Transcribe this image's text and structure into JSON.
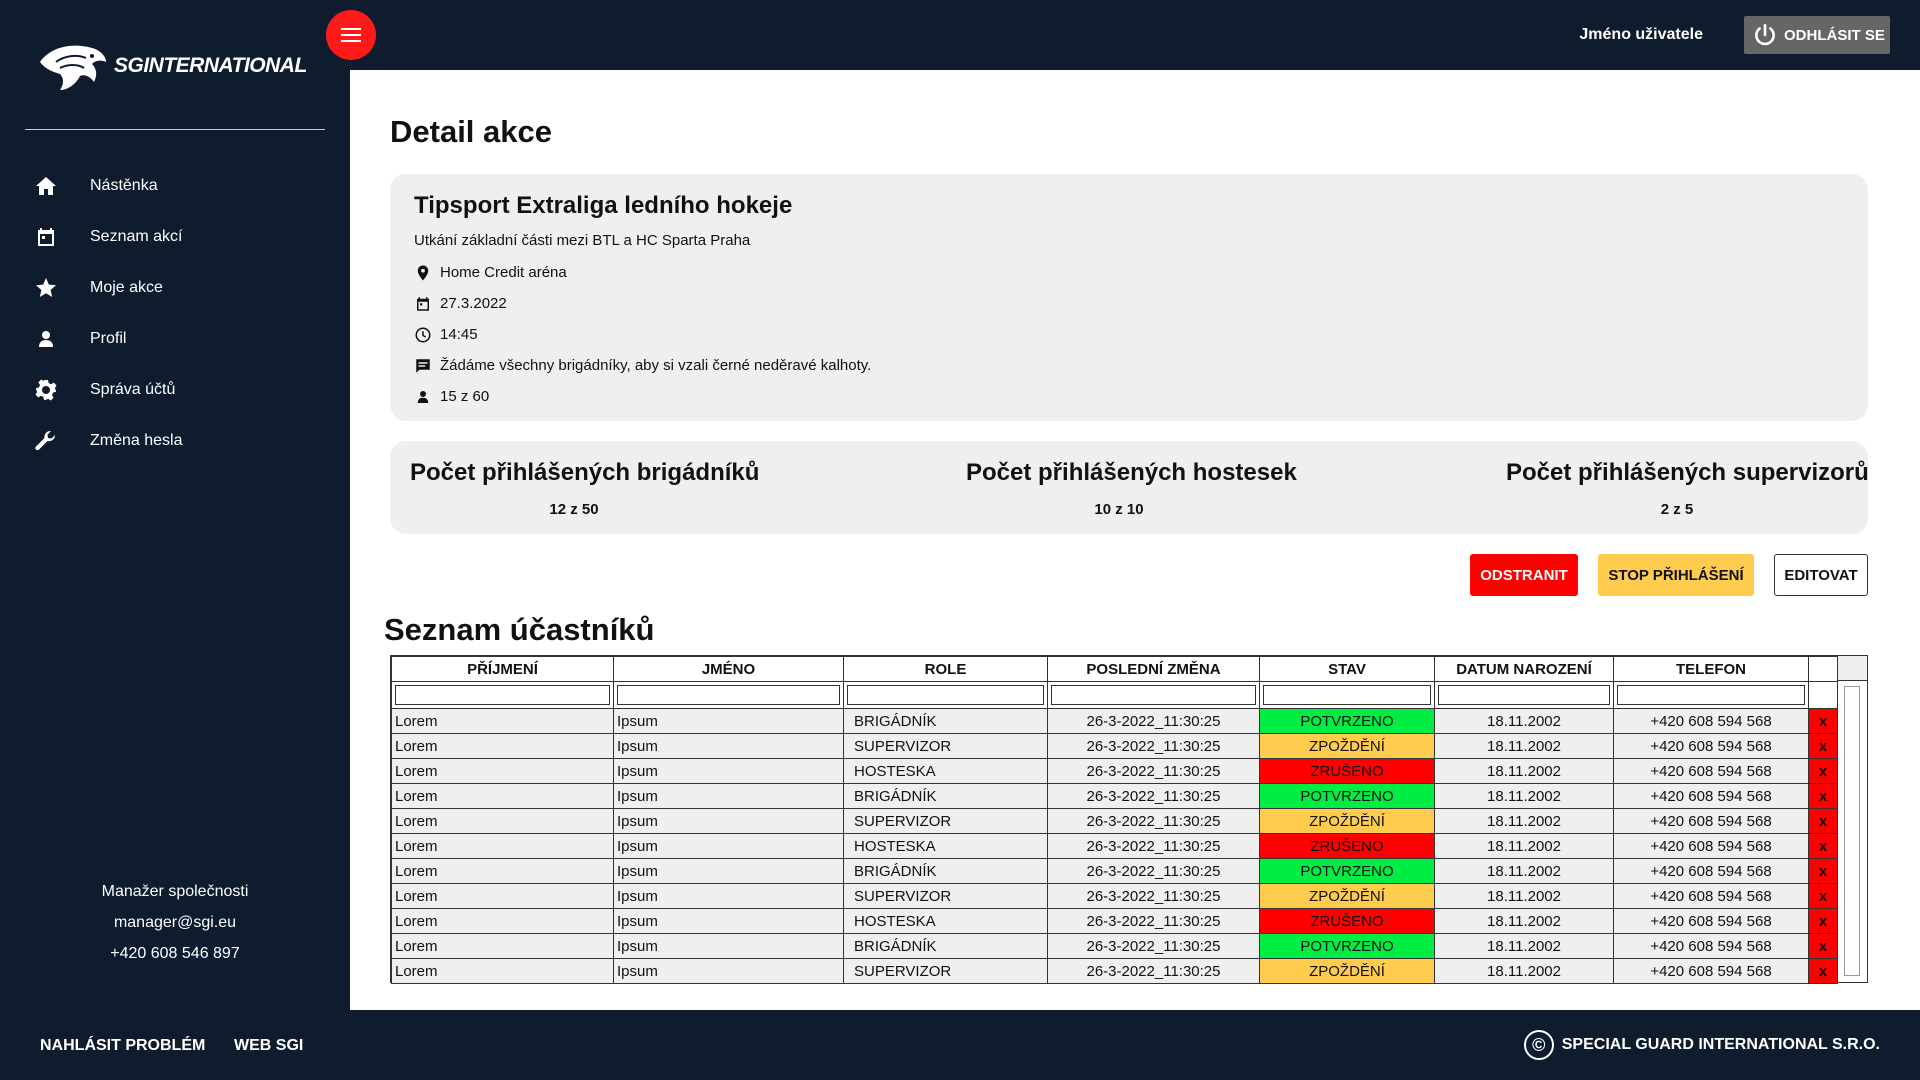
{
  "header": {
    "username": "Jméno uživatele",
    "logout_label": "ODHLÁSIT SE"
  },
  "brand": {
    "logo_text": "SGINTERNATIONAL"
  },
  "sidebar": {
    "items": [
      {
        "label": "Nástěnka",
        "icon": "home-icon"
      },
      {
        "label": "Seznam akcí",
        "icon": "calendar-icon"
      },
      {
        "label": "Moje akce",
        "icon": "star-icon"
      },
      {
        "label": "Profil",
        "icon": "user-icon"
      },
      {
        "label": "Správa účtů",
        "icon": "gear-icon"
      },
      {
        "label": "Změna hesla",
        "icon": "wrench-icon"
      }
    ],
    "contact": {
      "role": "Manažer společnosti",
      "email": "manager@sgi.eu",
      "phone": "+420 608 546 897"
    }
  },
  "main": {
    "page_title": "Detail akce",
    "event": {
      "title": "Tipsport Extraliga ledního hokeje",
      "description": "Utkání základní části mezi BTL a HC Sparta Praha",
      "location": "Home Credit aréna",
      "date": "27.3.2022",
      "time": "14:45",
      "note": "Žádáme všechny brigádníky, aby si vzali černé neděravé kalhoty.",
      "capacity": "15 z 60"
    },
    "stats": [
      {
        "title": "Počet přihlášených brigádníků",
        "value": "12 z 50"
      },
      {
        "title": "Počet přihlášených hostesek",
        "value": "10 z 10"
      },
      {
        "title": "Počet přihlášených supervizorů",
        "value": "2 z 5"
      }
    ],
    "actions": {
      "remove": "ODSTRANIT",
      "stop": "STOP PŘIHLÁŠENÍ",
      "edit": "EDITOVAT"
    },
    "list_title": "Seznam účastníků",
    "table": {
      "columns": [
        "PŘÍJMENÍ",
        "JMÉNO",
        "ROLE",
        "POSLEDNÍ ZMĚNA",
        "STAV",
        "DATUM NAROZENÍ",
        "TELEFON"
      ],
      "delete_label": "x",
      "rows": [
        {
          "surname": "Lorem",
          "name": "Ipsum",
          "role": "BRIGÁDNÍK",
          "changed": "26-3-2022_11:30:25",
          "status": "POTVRZENO",
          "status_type": "ok",
          "birth": "18.11.2002",
          "phone": "+420 608 594 568"
        },
        {
          "surname": "Lorem",
          "name": "Ipsum",
          "role": "SUPERVIZOR",
          "changed": "26-3-2022_11:30:25",
          "status": "ZPOŽDĚNÍ",
          "status_type": "late",
          "birth": "18.11.2002",
          "phone": "+420 608 594 568"
        },
        {
          "surname": "Lorem",
          "name": "Ipsum",
          "role": "HOSTESKA",
          "changed": "26-3-2022_11:30:25",
          "status": "ZRUŠENO",
          "status_type": "cancel",
          "birth": "18.11.2002",
          "phone": "+420 608 594 568"
        },
        {
          "surname": "Lorem",
          "name": "Ipsum",
          "role": "BRIGÁDNÍK",
          "changed": "26-3-2022_11:30:25",
          "status": "POTVRZENO",
          "status_type": "ok",
          "birth": "18.11.2002",
          "phone": "+420 608 594 568"
        },
        {
          "surname": "Lorem",
          "name": "Ipsum",
          "role": "SUPERVIZOR",
          "changed": "26-3-2022_11:30:25",
          "status": "ZPOŽDĚNÍ",
          "status_type": "late",
          "birth": "18.11.2002",
          "phone": "+420 608 594 568"
        },
        {
          "surname": "Lorem",
          "name": "Ipsum",
          "role": "HOSTESKA",
          "changed": "26-3-2022_11:30:25",
          "status": "ZRUŠENO",
          "status_type": "cancel",
          "birth": "18.11.2002",
          "phone": "+420 608 594 568"
        },
        {
          "surname": "Lorem",
          "name": "Ipsum",
          "role": "BRIGÁDNÍK",
          "changed": "26-3-2022_11:30:25",
          "status": "POTVRZENO",
          "status_type": "ok",
          "birth": "18.11.2002",
          "phone": "+420 608 594 568"
        },
        {
          "surname": "Lorem",
          "name": "Ipsum",
          "role": "SUPERVIZOR",
          "changed": "26-3-2022_11:30:25",
          "status": "ZPOŽDĚNÍ",
          "status_type": "late",
          "birth": "18.11.2002",
          "phone": "+420 608 594 568"
        },
        {
          "surname": "Lorem",
          "name": "Ipsum",
          "role": "HOSTESKA",
          "changed": "26-3-2022_11:30:25",
          "status": "ZRUŠENO",
          "status_type": "cancel",
          "birth": "18.11.2002",
          "phone": "+420 608 594 568"
        },
        {
          "surname": "Lorem",
          "name": "Ipsum",
          "role": "BRIGÁDNÍK",
          "changed": "26-3-2022_11:30:25",
          "status": "POTVRZENO",
          "status_type": "ok",
          "birth": "18.11.2002",
          "phone": "+420 608 594 568"
        },
        {
          "surname": "Lorem",
          "name": "Ipsum",
          "role": "SUPERVIZOR",
          "changed": "26-3-2022_11:30:25",
          "status": "ZPOŽDĚNÍ",
          "status_type": "late",
          "birth": "18.11.2002",
          "phone": "+420 608 594 568"
        }
      ]
    }
  },
  "footer": {
    "report_problem": "NAHLÁSIT PROBLÉM",
    "web": "WEB SGI",
    "copyright": "SPECIAL GUARD INTERNATIONAL S.R.O."
  },
  "colors": {
    "background": "#0f1c2e",
    "accent": "#ff1a1a",
    "status_ok": "#00ee44",
    "status_late": "#ffcc4d",
    "status_cancel": "#ff0000"
  }
}
